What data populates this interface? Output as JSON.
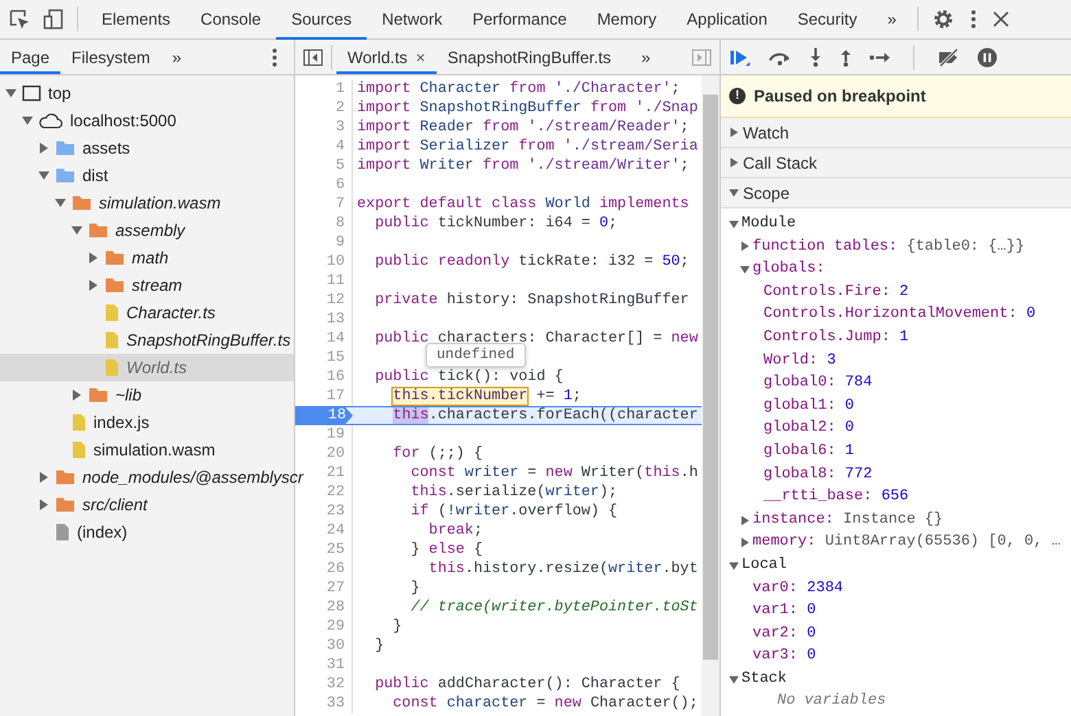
{
  "main_tabs": [
    {
      "label": "Elements",
      "selected": false
    },
    {
      "label": "Console",
      "selected": false
    },
    {
      "label": "Sources",
      "selected": true
    },
    {
      "label": "Network",
      "selected": false
    },
    {
      "label": "Performance",
      "selected": false
    },
    {
      "label": "Memory",
      "selected": false
    },
    {
      "label": "Application",
      "selected": false
    },
    {
      "label": "Security",
      "selected": false
    }
  ],
  "more_tabs": "»",
  "navigator": {
    "tabs": [
      {
        "label": "Page",
        "selected": true
      },
      {
        "label": "Filesystem",
        "selected": false
      }
    ],
    "more": "»",
    "tree": [
      {
        "label": "top",
        "kind": "frame",
        "expanded": true,
        "selected": false,
        "children": [
          {
            "label": "localhost:5000",
            "kind": "domain",
            "expanded": true,
            "selected": false,
            "children": [
              {
                "label": "assets",
                "kind": "folder",
                "expanded": false,
                "selected": false
              },
              {
                "label": "dist",
                "kind": "folder",
                "expanded": true,
                "selected": false,
                "children": [
                  {
                    "label": "simulation.wasm",
                    "kind": "mapped-folder",
                    "expanded": true,
                    "selected": false,
                    "children": [
                      {
                        "label": "assembly",
                        "kind": "mapped-folder",
                        "expanded": true,
                        "selected": false,
                        "children": [
                          {
                            "label": "math",
                            "kind": "mapped-folder",
                            "expanded": false,
                            "selected": false
                          },
                          {
                            "label": "stream",
                            "kind": "mapped-folder",
                            "expanded": false,
                            "selected": false
                          },
                          {
                            "label": "Character.ts",
                            "kind": "mapped-file",
                            "selected": false
                          },
                          {
                            "label": "SnapshotRingBuffer.ts",
                            "kind": "mapped-file",
                            "selected": false
                          },
                          {
                            "label": "World.ts",
                            "kind": "mapped-file",
                            "selected": true
                          }
                        ]
                      },
                      {
                        "label": "~lib",
                        "kind": "mapped-folder",
                        "expanded": false,
                        "selected": false
                      }
                    ]
                  },
                  {
                    "label": "index.js",
                    "kind": "file",
                    "selected": false
                  },
                  {
                    "label": "simulation.wasm",
                    "kind": "file",
                    "selected": false
                  }
                ]
              },
              {
                "label": "node_modules/@assemblyscr",
                "kind": "mapped-folder",
                "expanded": false,
                "selected": false
              },
              {
                "label": "src/client",
                "kind": "mapped-folder",
                "expanded": false,
                "selected": false
              },
              {
                "label": "(index)",
                "kind": "document",
                "selected": false
              }
            ]
          }
        ]
      }
    ]
  },
  "editor": {
    "tabs": [
      {
        "label": "World.ts",
        "selected": true,
        "close": "×"
      },
      {
        "label": "SnapshotRingBuffer.ts",
        "selected": false
      }
    ],
    "more": "»",
    "tooltip": "undefined",
    "lines": [
      {
        "n": "1",
        "paused": false,
        "tokens": [
          {
            "kind": "keyword",
            "text": "import"
          },
          {
            "kind": "def",
            "text": " Character"
          },
          {
            "kind": "keyword",
            "text": " from"
          },
          {
            "kind": "string",
            "text": " './Character'"
          },
          {
            "kind": "plain",
            "text": ";"
          }
        ]
      },
      {
        "n": "2",
        "paused": false,
        "tokens": [
          {
            "kind": "keyword",
            "text": "import"
          },
          {
            "kind": "def",
            "text": " SnapshotRingBuffer"
          },
          {
            "kind": "keyword",
            "text": " from"
          },
          {
            "kind": "string",
            "text": " './Snap"
          }
        ]
      },
      {
        "n": "3",
        "paused": false,
        "tokens": [
          {
            "kind": "keyword",
            "text": "import"
          },
          {
            "kind": "def",
            "text": " Reader"
          },
          {
            "kind": "keyword",
            "text": " from"
          },
          {
            "kind": "string",
            "text": " './stream/Reader'"
          },
          {
            "kind": "plain",
            "text": ";"
          }
        ]
      },
      {
        "n": "4",
        "paused": false,
        "tokens": [
          {
            "kind": "keyword",
            "text": "import"
          },
          {
            "kind": "def",
            "text": " Serializer"
          },
          {
            "kind": "keyword",
            "text": " from"
          },
          {
            "kind": "string",
            "text": " './stream/Seria"
          }
        ]
      },
      {
        "n": "5",
        "paused": false,
        "tokens": [
          {
            "kind": "keyword",
            "text": "import"
          },
          {
            "kind": "def",
            "text": " Writer"
          },
          {
            "kind": "keyword",
            "text": " from"
          },
          {
            "kind": "string",
            "text": " './stream/Writer'"
          },
          {
            "kind": "plain",
            "text": ";"
          }
        ]
      },
      {
        "n": "6",
        "paused": false
      },
      {
        "n": "7",
        "paused": false,
        "tokens": [
          {
            "kind": "keyword",
            "text": "export default class"
          },
          {
            "kind": "def",
            "text": " World"
          },
          {
            "kind": "keyword",
            "text": " implements"
          }
        ]
      },
      {
        "n": "8",
        "paused": false,
        "tokens": [
          {
            "kind": "keyword",
            "text": "  public"
          },
          {
            "kind": "plain",
            "text": " tickNumber: i64 ="
          },
          {
            "kind": "number",
            "text": " 0"
          },
          {
            "kind": "plain",
            "text": ";"
          }
        ]
      },
      {
        "n": "9",
        "paused": false
      },
      {
        "n": "10",
        "paused": false,
        "tokens": [
          {
            "kind": "keyword",
            "text": "  public readonly"
          },
          {
            "kind": "plain",
            "text": " tickRate: i32 ="
          },
          {
            "kind": "number",
            "text": " 50"
          },
          {
            "kind": "plain",
            "text": ";"
          }
        ]
      },
      {
        "n": "11",
        "paused": false
      },
      {
        "n": "12",
        "paused": false,
        "tokens": [
          {
            "kind": "keyword",
            "text": "  private"
          },
          {
            "kind": "plain",
            "text": " history: SnapshotRingBuffer"
          }
        ]
      },
      {
        "n": "13",
        "paused": false
      },
      {
        "n": "14",
        "paused": false,
        "tokens": [
          {
            "kind": "keyword",
            "text": "  public"
          },
          {
            "kind": "plain",
            "text": " characters: Character[] ="
          },
          {
            "kind": "keyword",
            "text": " new"
          }
        ]
      },
      {
        "n": "15",
        "paused": false
      },
      {
        "n": "16",
        "paused": false,
        "tokens": [
          {
            "kind": "keyword",
            "text": "  public"
          },
          {
            "kind": "plain",
            "text": " tick(): void {"
          }
        ]
      },
      {
        "n": "17",
        "paused": false,
        "tokens": [
          {
            "kind": "eval",
            "text": "    this.tickNumber"
          },
          {
            "kind": "plain",
            "text": " +="
          },
          {
            "kind": "number",
            "text": " 1"
          },
          {
            "kind": "plain",
            "text": ";"
          }
        ]
      },
      {
        "n": "18",
        "paused": true,
        "tokens": [
          {
            "kind": "hit",
            "text": "    this"
          },
          {
            "kind": "plain",
            "text": ".characters.forEach((character"
          }
        ]
      },
      {
        "n": "19",
        "paused": false
      },
      {
        "n": "20",
        "paused": false,
        "tokens": [
          {
            "kind": "keyword",
            "text": "    for"
          },
          {
            "kind": "plain",
            "text": " (;;) {"
          }
        ]
      },
      {
        "n": "21",
        "paused": false,
        "tokens": [
          {
            "kind": "keyword",
            "text": "      const"
          },
          {
            "kind": "def",
            "text": " writer"
          },
          {
            "kind": "plain",
            "text": " ="
          },
          {
            "kind": "keyword",
            "text": " new"
          },
          {
            "kind": "plain",
            "text": " Writer("
          },
          {
            "kind": "keyword",
            "text": "this"
          },
          {
            "kind": "plain",
            "text": ".h"
          }
        ]
      },
      {
        "n": "22",
        "paused": false,
        "tokens": [
          {
            "kind": "keyword",
            "text": "      this"
          },
          {
            "kind": "plain",
            "text": ".serialize("
          },
          {
            "kind": "def",
            "text": "writer"
          },
          {
            "kind": "plain",
            "text": ");"
          }
        ]
      },
      {
        "n": "23",
        "paused": false,
        "tokens": [
          {
            "kind": "keyword",
            "text": "      if"
          },
          {
            "kind": "plain",
            "text": " (!"
          },
          {
            "kind": "def",
            "text": "writer"
          },
          {
            "kind": "plain",
            "text": ".overflow) {"
          }
        ]
      },
      {
        "n": "24",
        "paused": false,
        "tokens": [
          {
            "kind": "keyword",
            "text": "        break"
          },
          {
            "kind": "plain",
            "text": ";"
          }
        ]
      },
      {
        "n": "25",
        "paused": false,
        "tokens": [
          {
            "kind": "plain",
            "text": "      }"
          },
          {
            "kind": "keyword",
            "text": " else"
          },
          {
            "kind": "plain",
            "text": " {"
          }
        ]
      },
      {
        "n": "26",
        "paused": false,
        "tokens": [
          {
            "kind": "keyword",
            "text": "        this"
          },
          {
            "kind": "plain",
            "text": ".history.resize("
          },
          {
            "kind": "def",
            "text": "writer"
          },
          {
            "kind": "plain",
            "text": ".byt"
          }
        ]
      },
      {
        "n": "27",
        "paused": false,
        "tokens": [
          {
            "kind": "plain",
            "text": "      }"
          }
        ]
      },
      {
        "n": "28",
        "paused": false,
        "tokens": [
          {
            "kind": "comment",
            "text": "      // trace(writer.bytePointer.toSt"
          }
        ]
      },
      {
        "n": "29",
        "paused": false,
        "tokens": [
          {
            "kind": "plain",
            "text": "    }"
          }
        ]
      },
      {
        "n": "30",
        "paused": false,
        "tokens": [
          {
            "kind": "plain",
            "text": "  }"
          }
        ]
      },
      {
        "n": "31",
        "paused": false
      },
      {
        "n": "32",
        "paused": false,
        "tokens": [
          {
            "kind": "keyword",
            "text": "  public"
          },
          {
            "kind": "plain",
            "text": " addCharacter(): Character {"
          }
        ]
      },
      {
        "n": "33",
        "paused": false,
        "tokens": [
          {
            "kind": "keyword",
            "text": "    const"
          },
          {
            "kind": "def",
            "text": " character"
          },
          {
            "kind": "plain",
            "text": " ="
          },
          {
            "kind": "keyword",
            "text": " new"
          },
          {
            "kind": "plain",
            "text": " Character();"
          }
        ]
      }
    ]
  },
  "debugger": {
    "banner": "Paused on breakpoint",
    "banner_icon": "!",
    "sections": [
      {
        "label": "Watch",
        "expanded": false
      },
      {
        "label": "Call Stack",
        "expanded": false
      },
      {
        "label": "Scope",
        "expanded": true
      }
    ],
    "scope": [
      {
        "kind": "scope",
        "label": "Module",
        "expanded": true,
        "children": [
          {
            "kind": "object",
            "name": "function tables:",
            "value": "{table0: {…}}",
            "expanded": false
          },
          {
            "kind": "object",
            "name": "globals:",
            "expanded": true,
            "children": [
              {
                "kind": "number",
                "name": "Controls.Fire:",
                "value": "2"
              },
              {
                "kind": "number",
                "name": "Controls.HorizontalMovement:",
                "value": "0"
              },
              {
                "kind": "number",
                "name": "Controls.Jump:",
                "value": "1"
              },
              {
                "kind": "number",
                "name": "World:",
                "value": "3"
              },
              {
                "kind": "number",
                "name": "global0:",
                "value": "784"
              },
              {
                "kind": "number",
                "name": "global1:",
                "value": "0"
              },
              {
                "kind": "number",
                "name": "global2:",
                "value": "0"
              },
              {
                "kind": "number",
                "name": "global6:",
                "value": "1"
              },
              {
                "kind": "number",
                "name": "global8:",
                "value": "772"
              },
              {
                "kind": "number",
                "name": "__rtti_base:",
                "value": "656"
              }
            ]
          },
          {
            "kind": "object",
            "name": "instance:",
            "value": "Instance {}",
            "expanded": false
          },
          {
            "kind": "object",
            "name": "memory:",
            "value": "Uint8Array(65536) [0, 0, …",
            "expanded": false
          }
        ]
      },
      {
        "kind": "scope",
        "label": "Local",
        "expanded": true,
        "children": [
          {
            "kind": "number",
            "name": "var0:",
            "value": "2384"
          },
          {
            "kind": "number",
            "name": "var1:",
            "value": "0"
          },
          {
            "kind": "number",
            "name": "var2:",
            "value": "0"
          },
          {
            "kind": "number",
            "name": "var3:",
            "value": "0"
          }
        ]
      },
      {
        "kind": "scope",
        "label": "Stack",
        "expanded": true,
        "children": [
          {
            "kind": "empty",
            "label": "No variables"
          }
        ]
      }
    ]
  }
}
